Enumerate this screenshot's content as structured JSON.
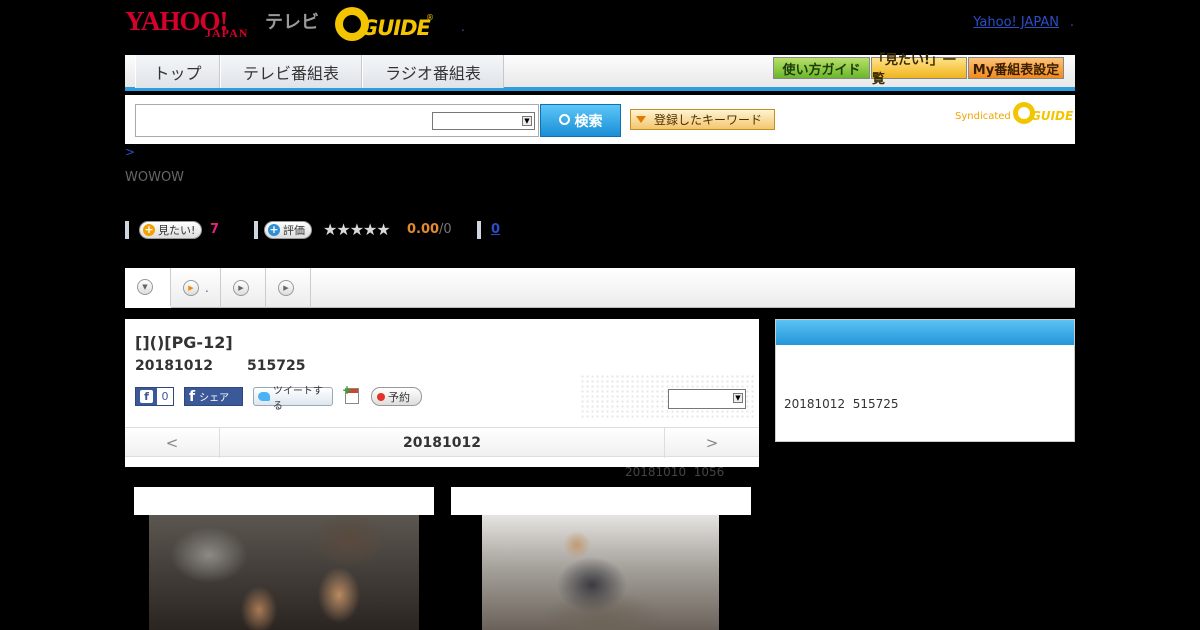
{
  "header": {
    "logo_yahoo": "YAHOO!",
    "logo_japan": "JAPAN",
    "logo_tv": "テレビ",
    "logo_gguide": "GUIDE",
    "logo_gguide_reg": "®",
    "dot1": ".",
    "yahoo_japan_link": "Yahoo! JAPAN",
    "dot2": "."
  },
  "nav": {
    "tabs": [
      {
        "label": "トップ"
      },
      {
        "label": "テレビ番組表"
      },
      {
        "label": "ラジオ番組表"
      }
    ],
    "guide_button": "使い方ガイド",
    "mitai_button": "「見たい!」一覧",
    "my_button": "My番組表設定"
  },
  "search": {
    "input_value": "",
    "select_value": "",
    "search_button": "検索",
    "keyword_button": "登録したキーワード",
    "syndicated": "Syndicated",
    "syndicated_logo": "GUIDE"
  },
  "breadcrumb": ">",
  "channel": "WOWOW",
  "stats": {
    "mitai_label": "見たい!",
    "mitai_count": "7",
    "rate_label": "評価",
    "stars": "★★★★★",
    "score": "0.00",
    "score_den": "/0",
    "comment_link": "0"
  },
  "tabs": [
    {
      "icon": "▼",
      "label": ""
    },
    {
      "icon": "▶",
      "label": "."
    },
    {
      "icon": "▶",
      "label": ""
    },
    {
      "icon": "▶",
      "label": ""
    }
  ],
  "program": {
    "title": "[]()[PG-12]",
    "meta": "20181012       515725",
    "fb_like": "f",
    "fb_count": "0",
    "fb_share_f": "f",
    "fb_share": "シェア",
    "tweet": "ツイートする",
    "reserve": "予約",
    "select_value": "",
    "date_prev": "<",
    "date_current": "20181012",
    "date_next": ">",
    "updated": "20181010  1056"
  },
  "side": {
    "text": "20181012  515725"
  },
  "colors": {
    "accent_blue": "#2d9fe0",
    "yahoo_red": "#d5002b",
    "gguide_yellow": "#f2c500",
    "pink_count": "#e0247a",
    "score_orange": "#e38a2e"
  }
}
